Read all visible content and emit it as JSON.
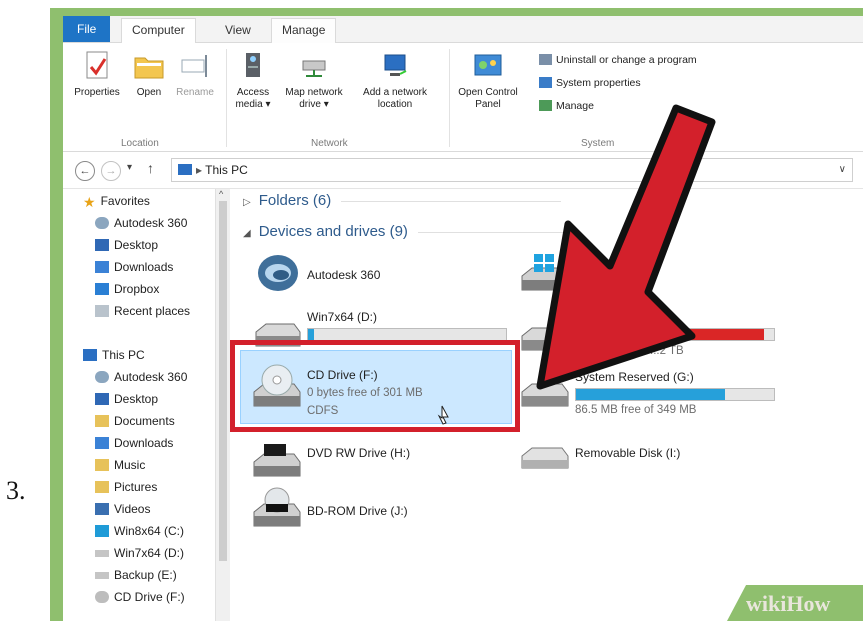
{
  "step_number": "3.",
  "ribbon_tabs": [
    "File",
    "Computer",
    "View",
    "Manage"
  ],
  "ribbon": {
    "location": {
      "label": "Location",
      "buttons": [
        "Properties",
        "Open",
        "Rename"
      ]
    },
    "network": {
      "label": "Network",
      "buttons": [
        "Access media ▾",
        "Map network drive ▾",
        "Add a network location"
      ]
    },
    "system": {
      "label": "System",
      "open_control_panel": "Open Control Panel",
      "items": [
        "Uninstall or change a program",
        "System properties",
        "Manage"
      ]
    }
  },
  "address": {
    "location": "This PC"
  },
  "nav": {
    "favorites_label": "Favorites",
    "favorites": [
      "Autodesk 360",
      "Desktop",
      "Downloads",
      "Dropbox",
      "Recent places"
    ],
    "thispc_label": "This PC",
    "thispc": [
      "Autodesk 360",
      "Desktop",
      "Documents",
      "Downloads",
      "Music",
      "Pictures",
      "Videos",
      "Win8x64 (C:)",
      "Win7x64 (D:)",
      "Backup (E:)",
      "CD Drive (F:)"
    ]
  },
  "content": {
    "folders_heading": "Folders (6)",
    "devices_heading": "Devices and drives (9)",
    "drives": {
      "autodesk": {
        "name": "Autodesk 360"
      },
      "win7": {
        "name": "Win7x64 (D:)",
        "used_fraction": 0.03
      },
      "cd": {
        "name": "CD Drive (F:)",
        "free": "0 bytes free of 301 MB",
        "fs": "CDFS"
      },
      "dvd": {
        "name": "DVD RW Drive (H:)"
      },
      "bd": {
        "name": "BD-ROM Drive (J:)"
      },
      "win8": {
        "name": "Wi"
      },
      "backup": {
        "free": "...2 TB",
        "used_fraction": 0.95
      },
      "sysres": {
        "name": "System Reserved (G:)",
        "free": "86.5 MB free of 349 MB",
        "used_fraction": 0.75
      },
      "removable": {
        "name": "Removable Disk (I:)"
      }
    }
  },
  "watermark": "wikiHow",
  "colors": {
    "file_tab": "#1e74c6",
    "arrow": "#d3202b",
    "frame": "#8fbf6e",
    "selection": "#cce8ff",
    "bar_fill": "#26a0da"
  }
}
